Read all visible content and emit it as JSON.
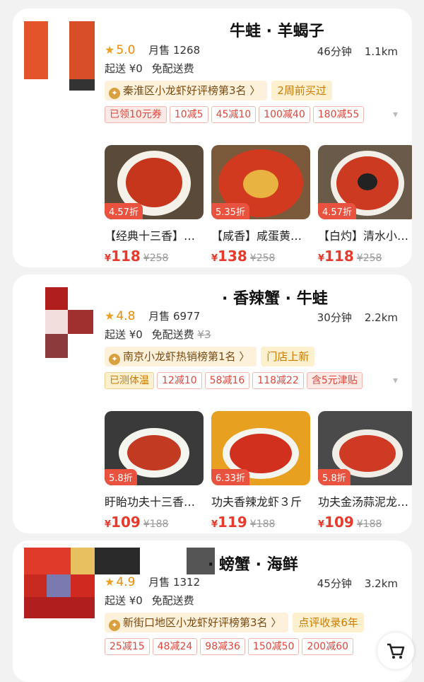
{
  "stores": [
    {
      "name": "牛蛙 · 羊蝎子",
      "rating": "5.0",
      "monthly_sales": "月售 1268",
      "delivery_time": "46分钟",
      "distance": "1.1km",
      "min_order": "起送 ¥0",
      "delivery_fee": "免配送费",
      "rank_label": "秦淮区小龙虾好评榜第3名 〉",
      "rank_extra": "2周前买过",
      "coupons": [
        "已领10元券",
        "10减5",
        "45减10",
        "100减40",
        "180减55"
      ],
      "dishes": [
        {
          "name": "【经典十三香】…",
          "discount": "4.57折",
          "price": "118",
          "original": "¥258"
        },
        {
          "name": "【咸香】咸蛋黄…",
          "discount": "5.35折",
          "price": "138",
          "original": "¥258"
        },
        {
          "name": "【白灼】清水小…",
          "discount": "4.57折",
          "price": "118",
          "original": "¥258"
        }
      ]
    },
    {
      "name": "· 香辣蟹 · 牛蛙",
      "rating": "4.8",
      "monthly_sales": "月售 6977",
      "delivery_time": "30分钟",
      "distance": "2.2km",
      "min_order": "起送 ¥0",
      "delivery_fee": "免配送费",
      "delivery_fee_original": "¥3",
      "rank_label": "南京小龙虾热销榜第1名 〉",
      "rank_extra": "门店上新",
      "coupons": [
        "已测体温",
        "12减10",
        "58减16",
        "118减22",
        "含5元津贴"
      ],
      "dishes": [
        {
          "name": "盱眙功夫十三香…",
          "discount": "5.8折",
          "price": "109",
          "original": "¥188"
        },
        {
          "name": "功夫香辣龙虾３斤",
          "discount": "6.33折",
          "price": "119",
          "original": "¥188"
        },
        {
          "name": "功夫金汤蒜泥龙…",
          "discount": "5.8折",
          "price": "109",
          "original": "¥188"
        }
      ]
    },
    {
      "name": "· 螃蟹 · 海鲜",
      "rating": "4.9",
      "monthly_sales": "月售 1312",
      "delivery_time": "45分钟",
      "distance": "3.2km",
      "min_order": "起送 ¥0",
      "delivery_fee": "免配送费",
      "rank_label": "新街口地区小龙虾好评榜第3名 〉",
      "rank_extra": "点评收录6年",
      "coupons": [
        "25减15",
        "48减24",
        "98减36",
        "150减50",
        "200减60"
      ]
    }
  ],
  "yen_symbol": "¥",
  "colors": {
    "accent": "#e8392c",
    "rating": "#f08a00",
    "gold_bg": "#fdf0cf"
  }
}
